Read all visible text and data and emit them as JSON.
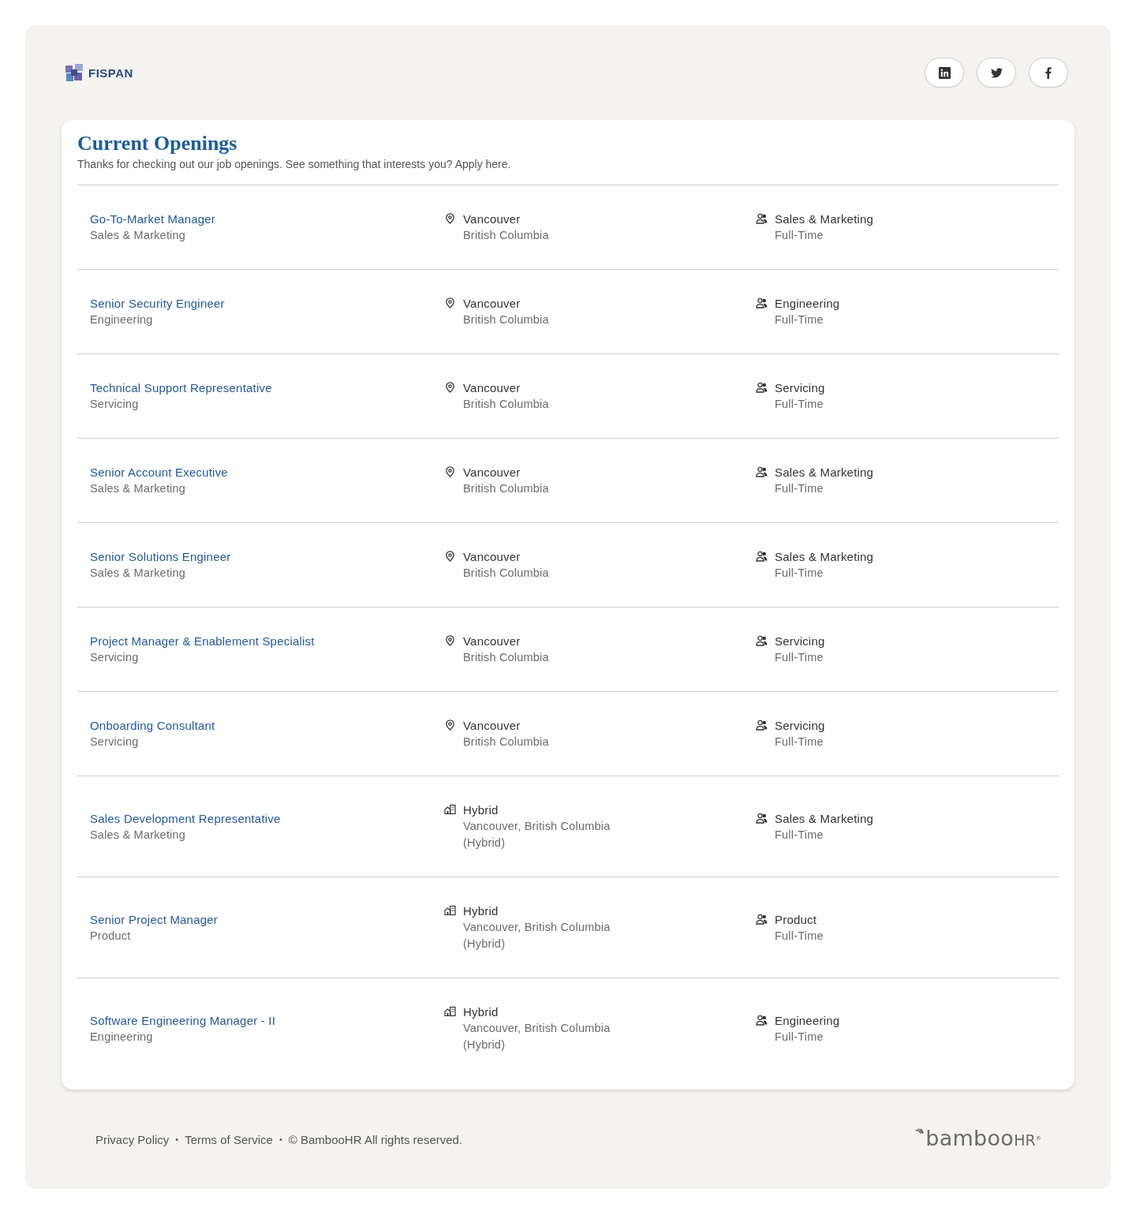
{
  "header": {
    "logo": {
      "text": "FISPAN"
    },
    "social_links": [
      {
        "kind": "linkedin"
      },
      {
        "kind": "twitter"
      },
      {
        "kind": "facebook"
      }
    ]
  },
  "openings": {
    "title": "Current Openings",
    "subtitle": "Thanks for checking out our job openings. See something that interests you? Apply here.",
    "jobs": [
      {
        "title": "Go-To-Market Manager",
        "department": "Sales & Marketing",
        "location": {
          "kind": "onsite",
          "lines": [
            "Vancouver",
            "British Columbia"
          ]
        },
        "team": "Sales & Marketing",
        "type": "Full-Time"
      },
      {
        "title": "Senior Security Engineer",
        "department": "Engineering",
        "location": {
          "kind": "onsite",
          "lines": [
            "Vancouver",
            "British Columbia"
          ]
        },
        "team": "Engineering",
        "type": "Full-Time"
      },
      {
        "title": "Technical Support Representative",
        "department": "Servicing",
        "location": {
          "kind": "onsite",
          "lines": [
            "Vancouver",
            "British Columbia"
          ]
        },
        "team": "Servicing",
        "type": "Full-Time"
      },
      {
        "title": "Senior Account Executive",
        "department": "Sales & Marketing",
        "location": {
          "kind": "onsite",
          "lines": [
            "Vancouver",
            "British Columbia"
          ]
        },
        "team": "Sales & Marketing",
        "type": "Full-Time"
      },
      {
        "title": "Senior Solutions Engineer",
        "department": "Sales & Marketing",
        "location": {
          "kind": "onsite",
          "lines": [
            "Vancouver",
            "British Columbia"
          ]
        },
        "team": "Sales & Marketing",
        "type": "Full-Time"
      },
      {
        "title": "Project Manager & Enablement Specialist",
        "department": "Servicing",
        "location": {
          "kind": "onsite",
          "lines": [
            "Vancouver",
            "British Columbia"
          ]
        },
        "team": "Servicing",
        "type": "Full-Time"
      },
      {
        "title": "Onboarding Consultant",
        "department": "Servicing",
        "location": {
          "kind": "onsite",
          "lines": [
            "Vancouver",
            "British Columbia"
          ]
        },
        "team": "Servicing",
        "type": "Full-Time"
      },
      {
        "title": "Sales Development Representative",
        "department": "Sales & Marketing",
        "location": {
          "kind": "hybrid",
          "lines": [
            "Hybrid",
            "Vancouver, British Columbia",
            "(Hybrid)"
          ]
        },
        "team": "Sales & Marketing",
        "type": "Full-Time"
      },
      {
        "title": "Senior Project Manager",
        "department": "Product",
        "location": {
          "kind": "hybrid",
          "lines": [
            "Hybrid",
            "Vancouver, British Columbia",
            "(Hybrid)"
          ]
        },
        "team": "Product",
        "type": "Full-Time"
      },
      {
        "title": "Software Engineering Manager - II",
        "department": "Engineering",
        "location": {
          "kind": "hybrid",
          "lines": [
            "Hybrid",
            "Vancouver, British Columbia",
            "(Hybrid)"
          ]
        },
        "team": "Engineering",
        "type": "Full-Time"
      }
    ]
  },
  "footer": {
    "items": [
      {
        "kind": "link",
        "text": "Privacy Policy"
      },
      {
        "kind": "separator",
        "text": "•"
      },
      {
        "kind": "link",
        "text": "Terms of Service"
      },
      {
        "kind": "separator",
        "text": "•"
      },
      {
        "kind": "text",
        "text": "© BambooHR All rights reserved."
      }
    ],
    "brand": {
      "name": "bamboo",
      "suffix": "HR",
      "mark": "®"
    }
  }
}
